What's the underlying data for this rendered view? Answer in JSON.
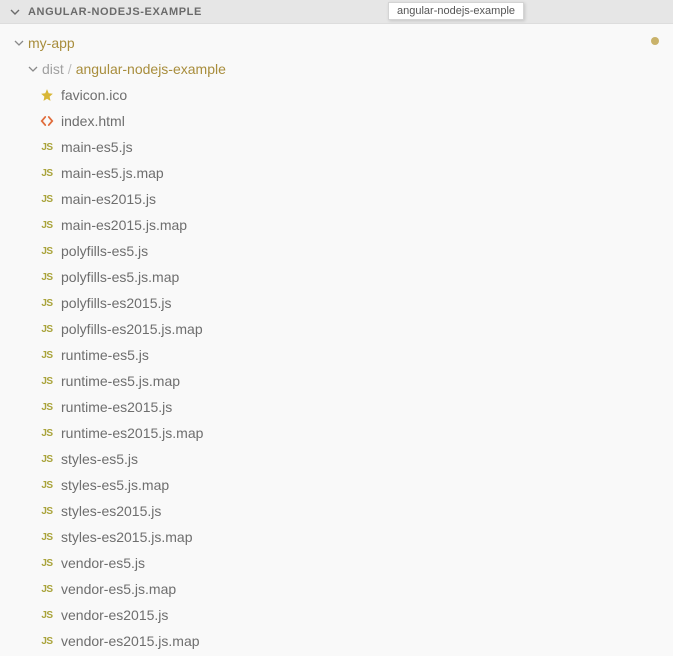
{
  "header": {
    "title": "ANGULAR-NODEJS-EXAMPLE"
  },
  "tooltip": "angular-nodejs-example",
  "tree": {
    "root": {
      "label": "my-app",
      "expanded": true
    },
    "distPath": {
      "prefix": "dist",
      "separator": "/",
      "name": "angular-nodejs-example",
      "expanded": true
    },
    "files": [
      {
        "icon": "star",
        "name": "favicon.ico"
      },
      {
        "icon": "html",
        "name": "index.html"
      },
      {
        "icon": "js",
        "name": "main-es5.js"
      },
      {
        "icon": "js",
        "name": "main-es5.js.map"
      },
      {
        "icon": "js",
        "name": "main-es2015.js"
      },
      {
        "icon": "js",
        "name": "main-es2015.js.map"
      },
      {
        "icon": "js",
        "name": "polyfills-es5.js"
      },
      {
        "icon": "js",
        "name": "polyfills-es5.js.map"
      },
      {
        "icon": "js",
        "name": "polyfills-es2015.js"
      },
      {
        "icon": "js",
        "name": "polyfills-es2015.js.map"
      },
      {
        "icon": "js",
        "name": "runtime-es5.js"
      },
      {
        "icon": "js",
        "name": "runtime-es5.js.map"
      },
      {
        "icon": "js",
        "name": "runtime-es2015.js"
      },
      {
        "icon": "js",
        "name": "runtime-es2015.js.map"
      },
      {
        "icon": "js",
        "name": "styles-es5.js"
      },
      {
        "icon": "js",
        "name": "styles-es5.js.map"
      },
      {
        "icon": "js",
        "name": "styles-es2015.js"
      },
      {
        "icon": "js",
        "name": "styles-es2015.js.map"
      },
      {
        "icon": "js",
        "name": "vendor-es5.js"
      },
      {
        "icon": "js",
        "name": "vendor-es5.js.map"
      },
      {
        "icon": "js",
        "name": "vendor-es2015.js"
      },
      {
        "icon": "js",
        "name": "vendor-es2015.js.map"
      }
    ]
  }
}
